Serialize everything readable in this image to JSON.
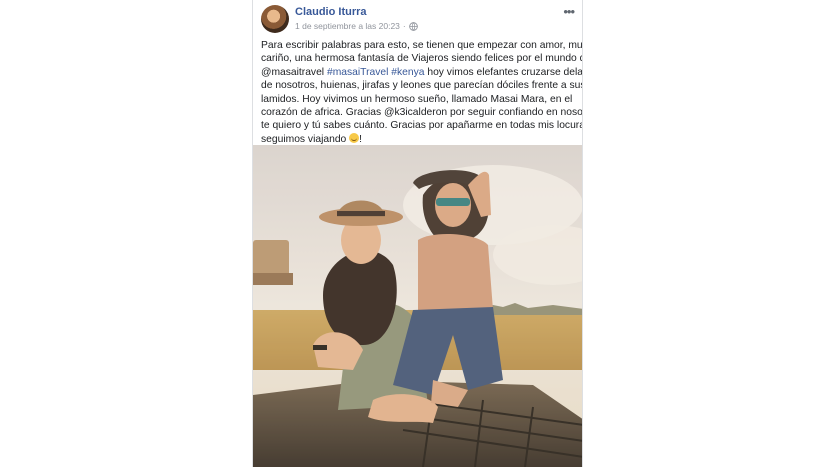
{
  "post": {
    "author": "Claudio Iturra",
    "timestamp": "1 de septiembre a las 20:23",
    "privacy_icon": "globe-icon",
    "more_icon": "more-options-icon",
    "text_lines": [
      [
        {
          "t": "Para escribir palabras para esto, se tienen que empezar con amor, mucho"
        }
      ],
      [
        {
          "t": "cariño, una hermosa fantasía de Viajeros siendo felices por el mundo de"
        }
      ],
      [
        {
          "t": "@masaitravel "
        },
        {
          "t": "#masaiTravel",
          "tag": true
        },
        {
          "t": " "
        },
        {
          "t": "#kenya",
          "tag": true
        },
        {
          "t": " hoy vimos elefantes cruzarse delante"
        }
      ],
      [
        {
          "t": "de nosotros, huienas, jirafas y leones que parecían dóciles frente a sus"
        }
      ],
      [
        {
          "t": "lamidos. Hoy vivimos un hermoso sueño, llamado Masai Mara, en el"
        }
      ],
      [
        {
          "t": "corazón de africa. Gracias @k3icalderon por seguir confiando en nosotros,"
        }
      ],
      [
        {
          "t": "te quiero y tú sabes cuánto. Gracias por apañarme en todas mis locuras "
        },
        {
          "emoji": "smile"
        }
      ],
      [
        {
          "t": "seguimos viajando "
        },
        {
          "emoji": "smile"
        },
        {
          "t": "!"
        }
      ]
    ],
    "photo_description_icon": "photo"
  },
  "colors": {
    "link": "#385898",
    "meta": "#90949c",
    "text": "#1c1e21"
  }
}
